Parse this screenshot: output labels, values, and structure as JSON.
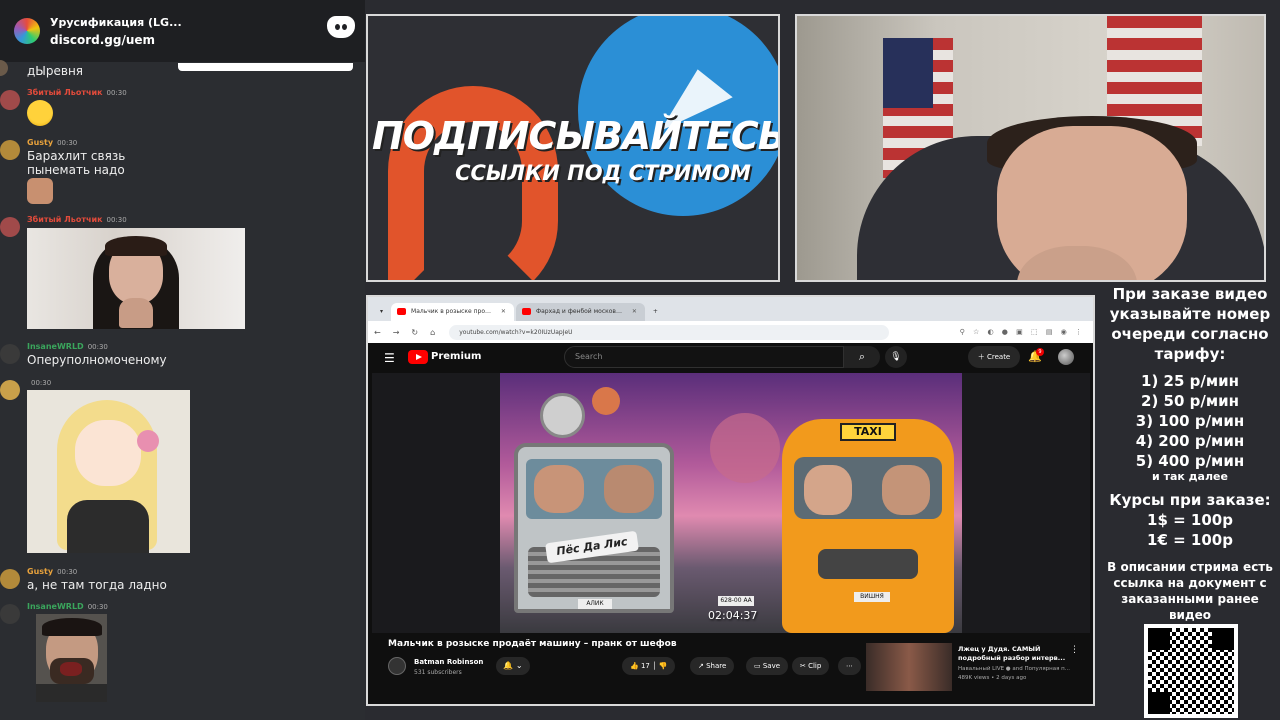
{
  "discord_invite": {
    "server_name": "Урусификация (LG...",
    "link": "discord.gg/uem"
  },
  "chat": [
    {
      "author": "",
      "time": "",
      "text": "дЫревня",
      "author_color": "#e8e8e8"
    },
    {
      "author": "Збитый Льотчик",
      "time": "00:30",
      "text": "",
      "attachment": "laughing-emoji",
      "author_color": "#e24b3b"
    },
    {
      "author": "Gusty",
      "time": "00:30",
      "text": "Барахлит связь\nпынемать надо",
      "attachment": "emoji-face",
      "author_color": "#e8a23c"
    },
    {
      "author": "Збитый Льотчик",
      "time": "00:30",
      "text": "",
      "attachment": "image-praying-man",
      "author_color": "#e24b3b"
    },
    {
      "author": "InsaneWRLD",
      "time": "00:30",
      "text": "Оперуполномоченому",
      "author_color": "#3aa55c"
    },
    {
      "author": "",
      "time": "00:30",
      "text": "",
      "attachment": "image-anime-girl",
      "author_color": "#3aa55c"
    },
    {
      "author": "Gusty",
      "time": "00:30",
      "text": "а, не там тогда ладно",
      "author_color": "#e8a23c"
    },
    {
      "author": "InsaneWRLD",
      "time": "00:30",
      "text": "",
      "attachment": "image-screaming-man",
      "author_color": "#3aa55c"
    }
  ],
  "promo": {
    "headline": "ПОДПИСЫВАЙТЕСЬ",
    "subline": "ССЫЛКИ ПОД СТРИМОМ"
  },
  "browser": {
    "tabs": [
      {
        "title": "Мальчик в розыске про…",
        "active": true
      },
      {
        "title": "Фархад и фенбой москов…",
        "active": false
      }
    ],
    "url": "youtube.com/watch?v=k20IUzUapJeU",
    "youtube": {
      "brand": "Premium",
      "search_placeholder": "Search",
      "create_label": "Create",
      "notifications": "9",
      "video": {
        "title": "Мальчик в розыске продаёт машину – пранк от шефов",
        "duration": "02:04:37",
        "thumb_sign": "Пёс Да Лис",
        "taxi_label": "TAXI",
        "plate_left": "АЛИК",
        "plate_mid": "628-00 АА",
        "plate_right": "ВИШНЯ",
        "channel": "Batman Robinson",
        "subscribers": "531 subscribers",
        "likes": "17",
        "share_label": "Share",
        "save_label": "Save",
        "clip_label": "Clip"
      },
      "related": {
        "title": "Лжец у Дудя. САМЫЙ подробный разбор интерв...",
        "channel": "Навальный LIVE ● and Популярная п...",
        "meta": "489K views • 2 days ago"
      }
    }
  },
  "info_panel": {
    "intro": "При заказе видео указывайте номер очереди согласно тарифу:",
    "tariffs": [
      "1) 25 р/мин",
      "2) 50 р/мин",
      "3) 100 р/мин",
      "4) 200 р/мин",
      "5) 400 р/мин"
    ],
    "etc": "и так далее",
    "rates_title": "Курсы при заказе:",
    "rates": [
      "1$ = 100р",
      "1€ = 100р"
    ],
    "description": "В описании стрима есть ссылка на документ с заказанными ранее видео"
  }
}
